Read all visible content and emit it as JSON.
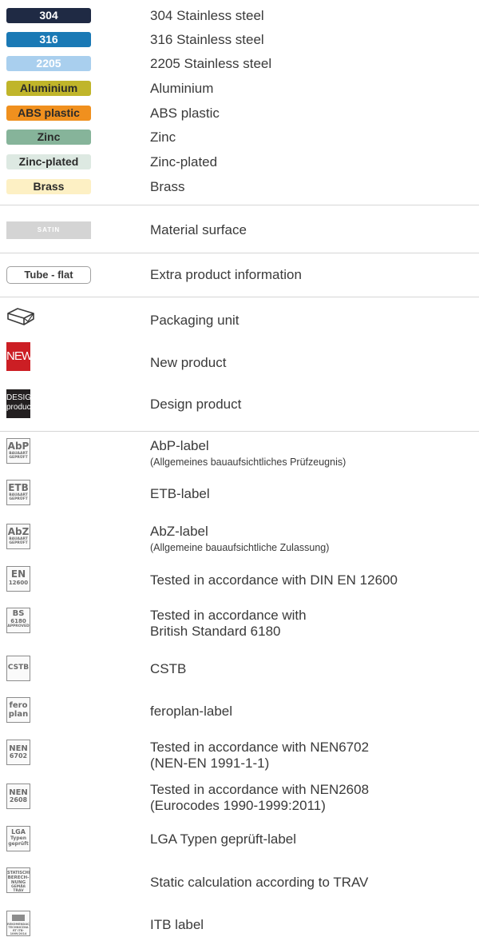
{
  "materials": [
    {
      "label": "304",
      "text": "304 Stainless steel",
      "bg": "#1f2a44",
      "fg": "#ffffff"
    },
    {
      "label": "316",
      "text": "316 Stainless steel",
      "bg": "#1a79b5",
      "fg": "#ffffff"
    },
    {
      "label": "2205",
      "text": "2205 Stainless steel",
      "bg": "#a9cfee",
      "fg": "#ffffff"
    },
    {
      "label": "Aluminium",
      "text": "Aluminium",
      "bg": "#c0b52a",
      "fg": "#2a2a2a"
    },
    {
      "label": "ABS plastic",
      "text": "ABS plastic",
      "bg": "#f0901e",
      "fg": "#2a2a2a"
    },
    {
      "label": "Zinc",
      "text": "Zinc",
      "bg": "#86b49a",
      "fg": "#2a2a2a"
    },
    {
      "label": "Zinc-plated",
      "text": "Zinc-plated",
      "bg": "#dde9e2",
      "fg": "#2a2a2a"
    },
    {
      "label": "Brass",
      "text": "Brass",
      "bg": "#fdf0c4",
      "fg": "#2a2a2a"
    }
  ],
  "surface": {
    "label": "SATIN",
    "text": "Material surface"
  },
  "extra": {
    "label": "Tube - flat",
    "text": "Extra product information"
  },
  "packaging": {
    "icon": "box-icon",
    "text": "Packaging unit"
  },
  "new_product": {
    "label": "NEW",
    "text": "New product"
  },
  "design_product": {
    "label_line1": "DESIGN",
    "label_line2": "product",
    "text": "Design product"
  },
  "certificates": {
    "abp": {
      "big": "AbP",
      "small1": "BAUAART",
      "small2": "GEPRÜFT",
      "text": "AbP-label",
      "sub": "(Allgemeines bauaufsichtliches Prüfzeugnis)"
    },
    "etb": {
      "big": "ETB",
      "small1": "BAUAART",
      "small2": "GEPRÜFT",
      "text": "ETB-label"
    },
    "abz": {
      "big": "AbZ",
      "small1": "BAUAART",
      "small2": "GEPRÜFT",
      "text": "AbZ-label",
      "sub": "(Allgemeine bauaufsichtliche Zulassung)"
    },
    "en": {
      "big": "EN",
      "mid": "12600",
      "text": "Tested in accordance with DIN EN 12600"
    },
    "bs": {
      "big": "BS",
      "mid": "6180",
      "small": "APPROVED",
      "text": "Tested in accordance with",
      "text2": "British Standard 6180"
    },
    "cstb": {
      "big": "CSTB",
      "text": "CSTB"
    },
    "feroplan": {
      "line1": "fero",
      "line2": "plan",
      "text": "feroplan-label"
    },
    "nen6702": {
      "big": "NEN",
      "mid": "6702",
      "text": "Tested in accordance with NEN6702",
      "text2": "(NEN-EN 1991-1-1)"
    },
    "nen2608": {
      "big": "NEN",
      "mid": "2608",
      "text": "Tested in accordance with NEN2608",
      "text2": "(Eurocodes 1990-1999:2011)"
    },
    "lga": {
      "big": "LGA",
      "mid1": "Typen",
      "mid2": "geprüft",
      "text": "LGA Typen geprüft-label"
    },
    "trav": {
      "l1": "STATISCHE",
      "l2": "BERECH-",
      "l3": "NUNG",
      "l4": "GEMÄß TRAV",
      "text": "Static calculation according to TRAV"
    },
    "itb": {
      "l1": "REKOMENDACJA",
      "l2": "TECHNICZNA",
      "l3": "RT ITB-1069/2014",
      "text": "ITB label"
    }
  }
}
